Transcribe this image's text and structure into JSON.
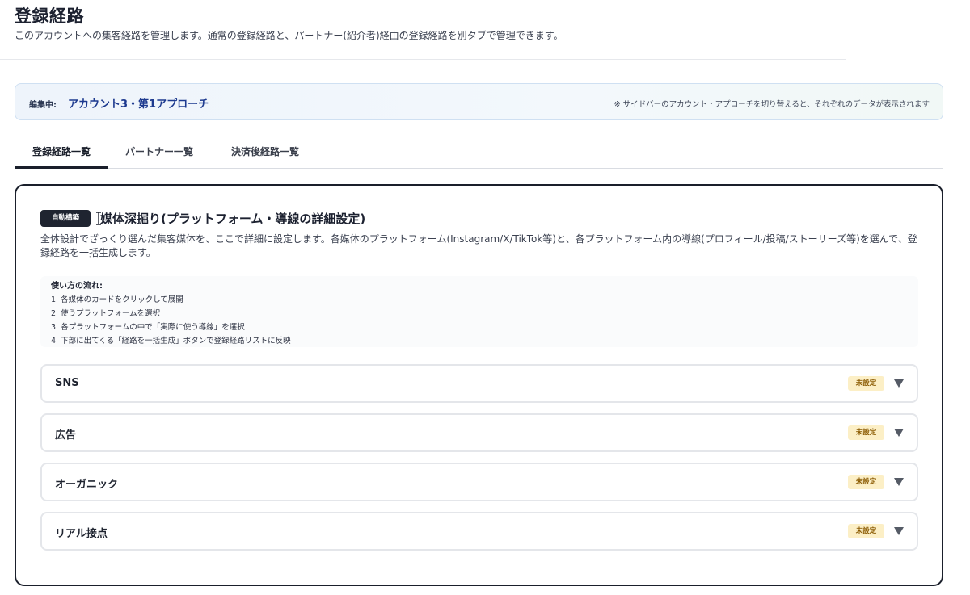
{
  "page": {
    "title": "登録経路",
    "description": "このアカウントへの集客経路を管理します。通常の登録経路と、パートナー(紹介者)経由の登録経路を別タブで管理できます。"
  },
  "context": {
    "label": "編集中:",
    "value": "アカウント3・第1アプローチ",
    "note": "※ サイドバーのアカウント・アプローチを切り替えると、それぞれのデータが表示されます"
  },
  "tabs": [
    {
      "label": "登録経路一覧",
      "active": true
    },
    {
      "label": "パートナー一覧",
      "active": false
    },
    {
      "label": "決済後経路一覧",
      "active": false
    }
  ],
  "section": {
    "badge": "自動構築",
    "title": "媒体深掘り(プラットフォーム・導線の詳細設定)",
    "description": "全体設計でざっくり選んだ集客媒体を、ここで詳細に設定します。各媒体のプラットフォーム(Instagram/X/TikTok等)と、各プラットフォーム内の導線(プロフィール/投稿/ストーリーズ等)を選んで、登録経路を一括生成します。",
    "howto": {
      "title": "使い方の流れ:",
      "steps": [
        "1. 各媒体のカードをクリックして展開",
        "2. 使うプラットフォームを選択",
        "3. 各プラットフォームの中で「実際に使う導線」を選択",
        "4. 下部に出てくる「経路を一括生成」ボタンで登録経路リストに反映"
      ]
    },
    "media": [
      {
        "label": "SNS",
        "status": "未設定"
      },
      {
        "label": "広告",
        "status": "未設定"
      },
      {
        "label": "オーガニック",
        "status": "未設定"
      },
      {
        "label": "リアル接点",
        "status": "未設定"
      }
    ]
  },
  "icons": {
    "cursor": "text-cursor-icon",
    "chevron": "chevron-down-icon"
  },
  "colors": {
    "badge_bg": "#1f2430",
    "status_bg": "#fcefc6",
    "context_value": "#1d3a8f"
  }
}
